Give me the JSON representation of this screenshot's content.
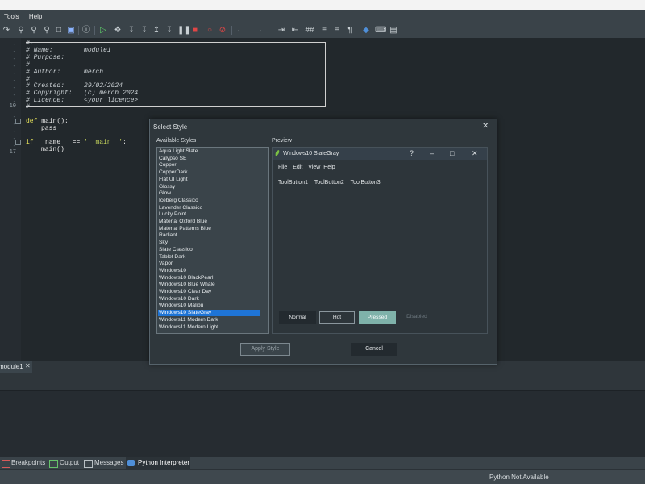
{
  "menu": {
    "items": [
      "Tools",
      "Help"
    ]
  },
  "toolbar": {
    "icons": [
      "undo-icon",
      "find-icon",
      "find-replace-icon",
      "find-files-icon",
      "open-folder-icon",
      "outline-icon",
      "info-icon",
      "run-icon",
      "debug-icon",
      "step-into-icon",
      "step-over-icon",
      "step-out-icon",
      "run-to-cursor-icon",
      "pause-icon",
      "stop-icon",
      "breakpoint-icon",
      "clear-breakpoints-icon",
      "back-icon",
      "forward-icon",
      "indent-icon",
      "comment-icon",
      "unindent-icon",
      "toggle-comment-icon",
      "paragraph-icon",
      "python-icon",
      "keyboard-icon",
      "layout-icon"
    ]
  },
  "editor": {
    "line_numbers": [
      "-",
      "-",
      "-",
      "-",
      "-",
      "-",
      "-",
      "-",
      "-",
      "10",
      "-",
      "-",
      "-",
      "-",
      "-",
      "-",
      "17"
    ],
    "lines": [
      "#-",
      "# Name:        module1",
      "# Purpose:",
      "#",
      "# Author:      merch",
      "#",
      "# Created:     29/02/2024",
      "# Copyright:   (c) merch 2024",
      "# Licence:     <your licence>",
      "#-"
    ],
    "code_def": "def",
    "code_main": "main():",
    "code_pass": "pass",
    "code_if": "if",
    "code_name": "__name__",
    "code_eq": "==",
    "code_str": "'__main__'",
    "code_colon": ":",
    "code_call": "main()"
  },
  "tabs": {
    "file_tab": "module1"
  },
  "bottom_tabs": [
    "Breakpoints",
    "Output",
    "Messages",
    "Python Interpreter"
  ],
  "status": {
    "text": "Python Not Available"
  },
  "dialog": {
    "title": "Select Style",
    "available_label": "Available Styles",
    "preview_label": "Preview",
    "styles": [
      "Aqua Light Slate",
      "Calypso SE",
      "Copper",
      "CopperDark",
      "Flat UI Light",
      "Glossy",
      "Glow",
      "Iceberg Classico",
      "Lavender Classico",
      "Lucky Point",
      "Material Oxford Blue",
      "Material Patterns Blue",
      "Radiant",
      "Sky",
      "Slate Classico",
      "Tablet Dark",
      "Vapor",
      "Windows10",
      "Windows10 BlackPearl",
      "Windows10 Blue Whale",
      "Windows10 Clear Day",
      "Windows10 Dark",
      "Windows10 Malibu",
      "Windows10 SlateGray",
      "Windows11 Modern Dark",
      "Windows11 Modern Light"
    ],
    "selected_style": "Windows10 SlateGray",
    "preview": {
      "window_title": "Windows10 SlateGray",
      "help_glyph": "?",
      "minimize_glyph": "–",
      "maximize_glyph": "□",
      "close_glyph": "✕",
      "menu": [
        "File",
        "Edit",
        "View",
        "Help"
      ],
      "tool_buttons": [
        "ToolButton1",
        "ToolButton2",
        "ToolButton3"
      ],
      "buttons": [
        "Normal",
        "Hot",
        "Pressed",
        "Disabled"
      ]
    },
    "apply_label": "Apply Style",
    "cancel_label": "Cancel",
    "close_glyph": "✕"
  },
  "colors": {
    "accent": "#1e74d6",
    "pressed": "#7fb2aa",
    "editor_bg": "#22282c"
  }
}
